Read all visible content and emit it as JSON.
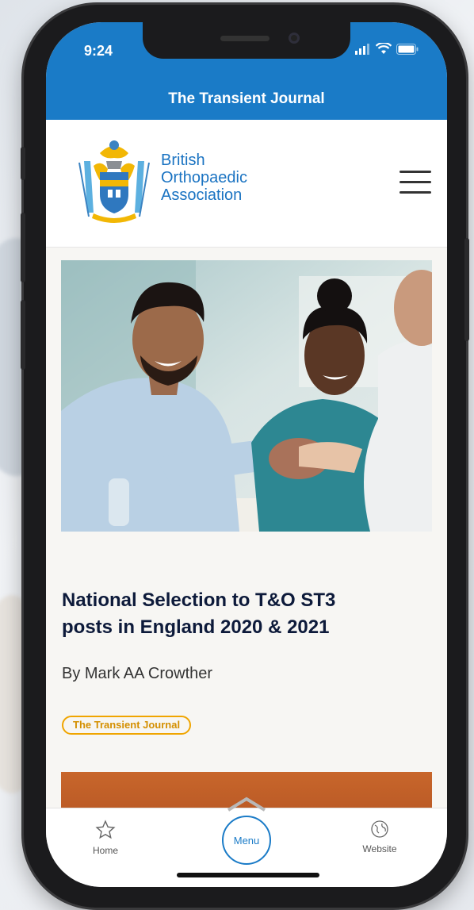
{
  "status_bar": {
    "time": "9:24"
  },
  "app_bar": {
    "title": "The Transient Journal"
  },
  "brand": {
    "line1": "British",
    "line2": "Orthopaedic",
    "line3": "Association",
    "color": "#1a73c2"
  },
  "article": {
    "title_line1": "National Selection to T&O ST3",
    "title_line2": "posts in England 2020 & 2021",
    "byline": "By Mark AA Crowther",
    "tag": "The Transient Journal",
    "tag_color": "#f0a500"
  },
  "bottom_nav": {
    "home_label": "Home",
    "menu_label": "Menu",
    "website_label": "Website",
    "accent": "#1a7bc7"
  },
  "icons": [
    "signal-icon",
    "wifi-icon",
    "battery-icon",
    "hamburger-icon",
    "star-icon",
    "globe-icon",
    "chevron-up-icon"
  ]
}
